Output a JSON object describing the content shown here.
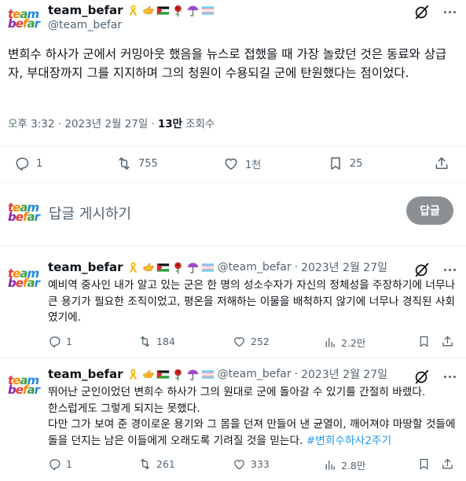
{
  "profile": {
    "logo_line1": [
      "t",
      "e",
      "a",
      "m"
    ],
    "logo_line2": [
      "b",
      "e",
      "f",
      "a",
      "r"
    ],
    "name": "team_befar",
    "handle": "@team_befar",
    "emojis": [
      "yellow-ribbon-icon",
      "hand-icon",
      "palestine-flag-icon",
      "rose-icon",
      "umbrella-icon",
      "trans-flag-icon"
    ]
  },
  "main_tweet": {
    "text": "변희수 하사가 군에서 커밍아웃 했음을 뉴스로 접했을 때 가장 놀랐던 것은 동료와 상급자, 부대장까지 그를 지지하며 그의 청원이 수용되길 군에 탄원했다는 점이었다.",
    "time": "오후 3:32 · 2023년 2월 27일 ·",
    "views_count": "13만",
    "views_label": "조회수",
    "stats": {
      "replies": "1",
      "retweets": "755",
      "likes": "1천",
      "bookmarks": "25"
    }
  },
  "reply_composer": {
    "placeholder": "답글 게시하기",
    "button_label": "답글"
  },
  "replies": [
    {
      "name": "team_befar",
      "handle": "@team_befar",
      "sep": "·",
      "date": "2023년 2월 27일",
      "text": "예비역 중사인 내가 알고 있는 군은 한 명의 성소수자가 자신의 정체성을 주장하기에 너무나 큰 용기가 필요한 조직이었고, 평온을 저해하는 이물을 배척하지 않기에 너무나 경직된 사회였기에.",
      "stats": {
        "replies": "1",
        "retweets": "184",
        "likes": "252",
        "views": "2.2만"
      }
    },
    {
      "name": "team_befar",
      "handle": "@team_befar",
      "sep": "·",
      "date": "2023년 2월 27일",
      "text_line1": "뛰어난 군인이었던 변희수 하사가 그의 원대로 군에 돌아갈 수 있기를 간절히 바랬다.",
      "text_line2": "한스럽게도 그렇게 되지는 못했다.",
      "text_line3": "다만 그가 보여 준 경이로운 용기와 그 몸을 던져 만들어 낸 균열이, 깨어져야 마땅할 것들에 돌을 던지는 남은 이들에게 오래도록 기려질 것을 믿는다.",
      "hashtag": "#변희수하사2주기",
      "stats": {
        "replies": "1",
        "retweets": "261",
        "likes": "333",
        "views": "2.8만"
      }
    }
  ],
  "colors": {
    "accent": "#1d9bf0",
    "muted": "#536471",
    "text": "#0f1419",
    "reply_button": "#8b9094"
  }
}
